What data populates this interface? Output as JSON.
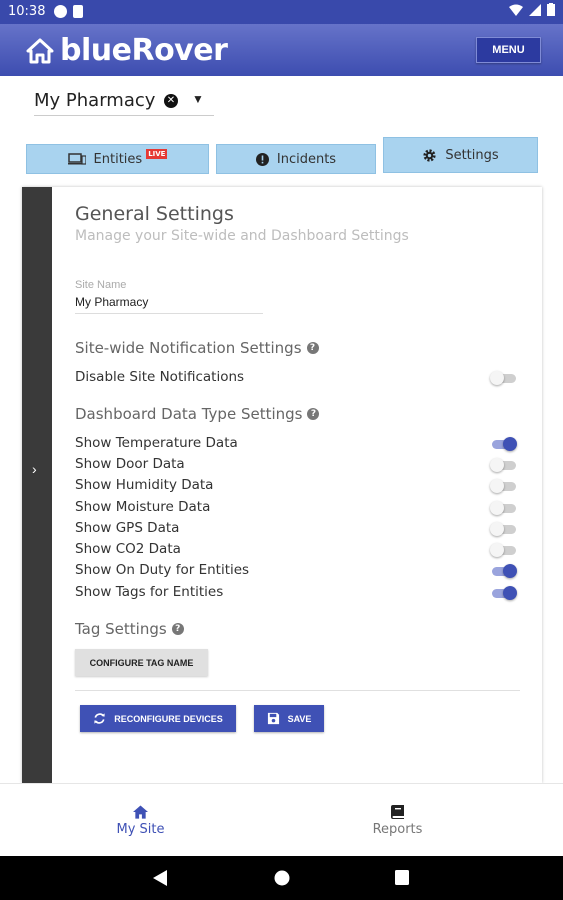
{
  "status_bar": {
    "time": "10:38"
  },
  "app_bar": {
    "brand": "blueRover",
    "menu_label": "MENU"
  },
  "site_selector": {
    "value": "My Pharmacy"
  },
  "tabs": [
    {
      "label": "Entities",
      "badge": "LIVE"
    },
    {
      "label": "Incidents"
    },
    {
      "label": "Settings"
    }
  ],
  "settings": {
    "title": "General Settings",
    "subtitle": "Manage your Site-wide and Dashboard Settings",
    "site_name_label": "Site Name",
    "site_name_value": "My Pharmacy",
    "notification_heading": "Site-wide Notification Settings",
    "disable_notifications": {
      "label": "Disable Site Notifications",
      "on": false
    },
    "data_type_heading": "Dashboard Data Type Settings",
    "toggles": [
      {
        "label": "Show Temperature Data",
        "on": true
      },
      {
        "label": "Show Door Data",
        "on": false
      },
      {
        "label": "Show Humidity Data",
        "on": false
      },
      {
        "label": "Show Moisture Data",
        "on": false
      },
      {
        "label": "Show GPS Data",
        "on": false
      },
      {
        "label": "Show CO2 Data",
        "on": false
      },
      {
        "label": "Show On Duty for Entities",
        "on": true
      },
      {
        "label": "Show Tags for Entities",
        "on": true
      }
    ],
    "tag_heading": "Tag Settings",
    "configure_tag_button": "CONFIGURE TAG NAME",
    "reconfigure_button": "RECONFIGURE DEVICES",
    "save_button": "SAVE"
  },
  "bottom_nav": [
    {
      "label": "My Site",
      "icon": "home-icon",
      "active": true
    },
    {
      "label": "Reports",
      "icon": "book-icon",
      "active": false
    }
  ],
  "colors": {
    "primary": "#3f51b5",
    "tab_bg": "#a9d3ef",
    "status_bar": "#3949ab"
  }
}
